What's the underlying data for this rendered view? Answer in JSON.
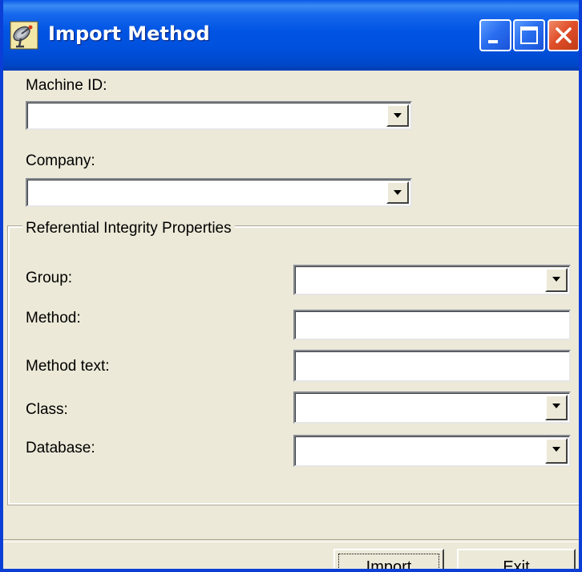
{
  "window": {
    "title": "Import Method"
  },
  "form": {
    "machine_id_label": "Machine ID:",
    "machine_id_value": "",
    "company_label": "Company:",
    "company_value": ""
  },
  "referential_integrity": {
    "title": "Referential Integrity Properties",
    "group_label": "Group:",
    "group_value": "",
    "method_label": "Method:",
    "method_value": "",
    "method_text_label": "Method text:",
    "method_text_value": "",
    "class_label": "Class:",
    "class_value": "",
    "database_label": "Database:",
    "database_value": ""
  },
  "buttons": {
    "import_label": "Import",
    "exit_label": "Exit"
  },
  "icons": {
    "app": "satellite-dish-icon",
    "minimize": "minimize-icon",
    "maximize": "maximize-icon",
    "close": "close-icon",
    "dropdown": "chevron-down-icon"
  },
  "colors": {
    "titlebar": "#0054e3",
    "close_button": "#e0502a",
    "dialog_background": "#ece9d8"
  }
}
